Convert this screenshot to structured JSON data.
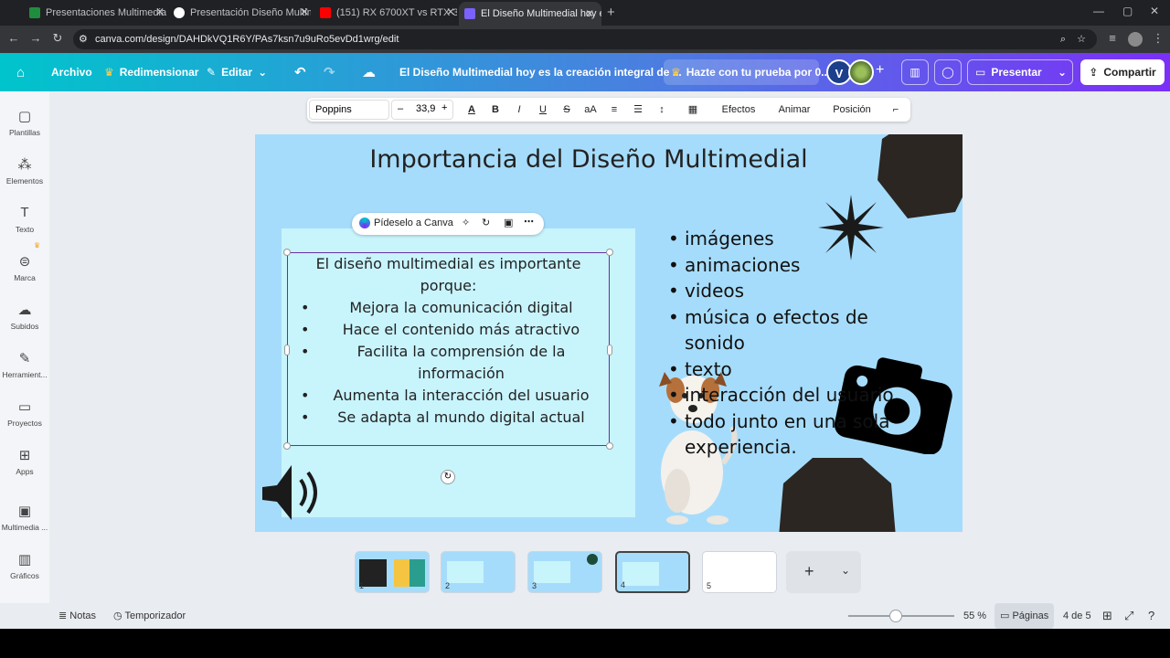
{
  "browser": {
    "tabs": [
      {
        "label": "Presentaciones Multimediales (",
        "color": "#1e8e3e"
      },
      {
        "label": "Presentación Diseño Multimedi",
        "color": "#ffffff"
      },
      {
        "label": "(151) RX 6700XT vs RTX 3070 T",
        "color": "#ff0000"
      },
      {
        "label": "El Diseño Multimedial hoy es la",
        "color": "#7b61ff"
      }
    ],
    "url": "canva.com/design/DAHDkVQ1R6Y/PAs7ksn7u9uRo5evDd1wrg/edit"
  },
  "header": {
    "archivo": "Archivo",
    "redimensionar": "Redimensionar",
    "editar": "Editar",
    "doc_title": "El Diseño Multimedial hoy es la creación integral de ...",
    "promo": "Hazte con tu prueba por 0...",
    "avatar_letter": "V",
    "presentar": "Presentar",
    "compartir": "Compartir"
  },
  "sidebar": {
    "items": [
      {
        "label": "Plantillas",
        "icon": "templates-icon"
      },
      {
        "label": "Elementos",
        "icon": "elements-icon"
      },
      {
        "label": "Texto",
        "icon": "text-icon"
      },
      {
        "label": "Marca",
        "icon": "brand-icon"
      },
      {
        "label": "Subidos",
        "icon": "uploads-icon"
      },
      {
        "label": "Herramient...",
        "icon": "tools-icon"
      },
      {
        "label": "Proyectos",
        "icon": "folder-icon"
      },
      {
        "label": "Apps",
        "icon": "apps-icon"
      },
      {
        "label": "Multimedia ...",
        "icon": "media-icon"
      },
      {
        "label": "Gráficos",
        "icon": "charts-icon"
      }
    ]
  },
  "toolbar": {
    "font": "Poppins",
    "minus": "–",
    "size": "33,9",
    "plus": "+",
    "effects": "Efectos",
    "animate": "Animar",
    "position": "Posición"
  },
  "slide": {
    "title": "Importancia del Diseño Multimedial",
    "ask_canva": "Pídeselo a Canva",
    "intro": "El diseño multimedial es importante porque:",
    "reasons": [
      "Mejora la comunicación digital",
      "Hace el contenido más atractivo",
      "Facilita la comprensión de la información",
      "Aumenta la interacción del usuario",
      "Se adapta al mundo digital actual"
    ],
    "elements": [
      "imágenes",
      "animaciones",
      "videos",
      "música o efectos de sonido",
      "texto",
      "interacción del usuario",
      "todo junto en una sola experiencia."
    ]
  },
  "pages": {
    "thumbnails": [
      "1",
      "2",
      "3",
      "4",
      "5"
    ],
    "current": 4
  },
  "footer": {
    "notes": "Notas",
    "timer": "Temporizador",
    "zoom": "55 %",
    "pages_label": "Páginas",
    "page_count": "4 de 5"
  }
}
